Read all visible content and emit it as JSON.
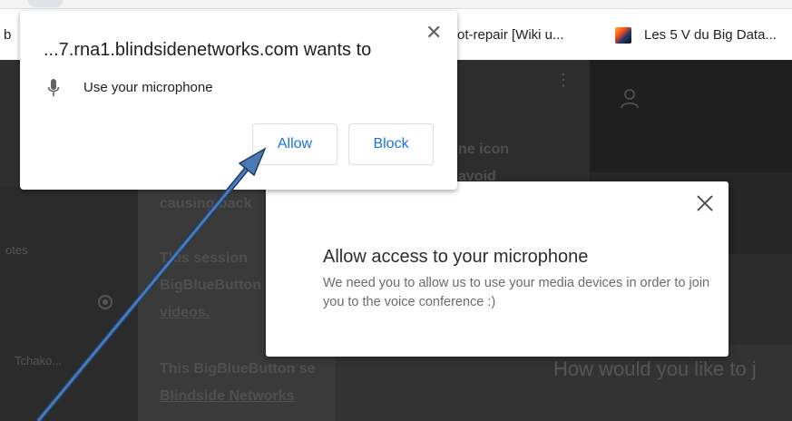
{
  "bookmarks_bar": {
    "items": [
      {
        "label": "b"
      },
      {
        "label": "ot-repair [Wiki u..."
      },
      {
        "label": "Les 5 V du Big Data..."
      }
    ],
    "icon": "photo-thumbnail-icon"
  },
  "background_page": {
    "chat_lines": [
      "ne icon",
      "avoid",
      "causing back",
      "This session",
      "BigBlueButton",
      "videos.",
      "This BigBlueButton se",
      "Blindside Networks"
    ],
    "sidebar_labels": [
      "otes",
      "Tchako..."
    ],
    "join_prompt": "How would you like to j"
  },
  "permission_prompt": {
    "origin_text": "...7.rna1.blindsidenetworks.com wants to",
    "request_text": "Use your microphone",
    "allow_label": "Allow",
    "block_label": "Block",
    "close_glyph": "✕",
    "accent_color": "#1a73e8"
  },
  "mic_modal": {
    "title": "Allow access to your microphone",
    "description": "We need you to allow us to use your media devices in order to join you to the voice conference :)"
  },
  "annotation": {
    "color": "#4a7ab5"
  }
}
